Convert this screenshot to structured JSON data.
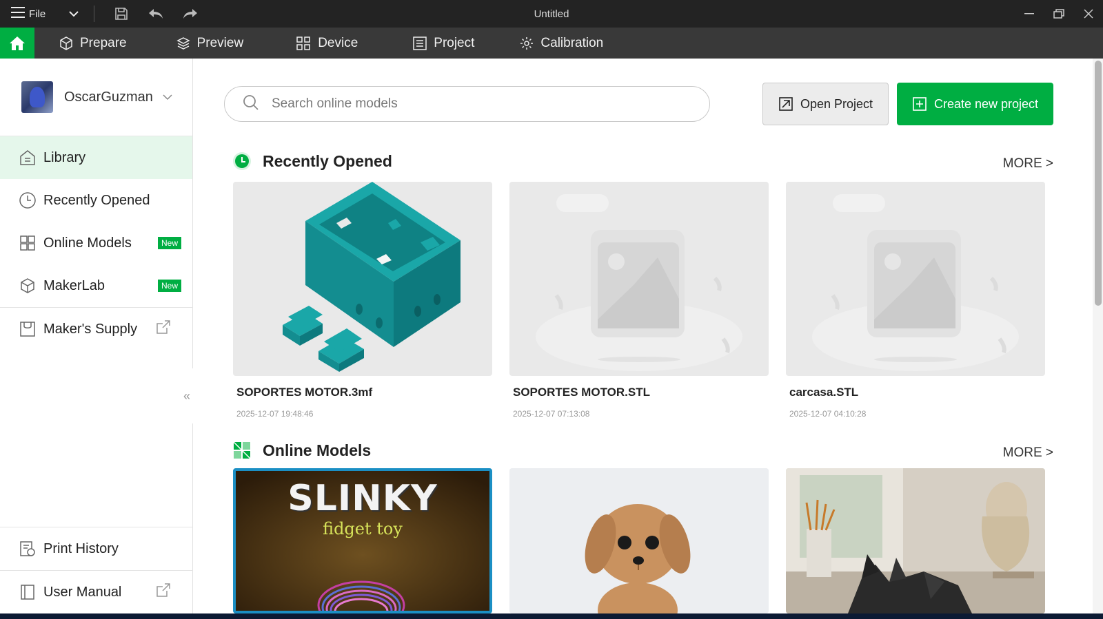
{
  "titlebar": {
    "file_label": "File",
    "title": "Untitled"
  },
  "nav": {
    "tabs": [
      {
        "label": "Prepare",
        "icon": "cube-icon"
      },
      {
        "label": "Preview",
        "icon": "layers-icon"
      },
      {
        "label": "Device",
        "icon": "device-icon"
      },
      {
        "label": "Project",
        "icon": "list-icon"
      },
      {
        "label": "Calibration",
        "icon": "gear-icon"
      }
    ]
  },
  "sidebar": {
    "username": "OscarGuzman",
    "items": [
      {
        "label": "Library",
        "icon": "home-icon",
        "active": true
      },
      {
        "label": "Recently Opened",
        "icon": "clock-icon"
      },
      {
        "label": "Online Models",
        "icon": "models-icon",
        "badge": "New"
      },
      {
        "label": "MakerLab",
        "icon": "makerlab-icon",
        "badge": "New"
      },
      {
        "label": "Maker's Supply",
        "icon": "store-icon"
      }
    ],
    "bottom": [
      {
        "label": "Print History",
        "icon": "history-icon"
      },
      {
        "label": "User Manual",
        "icon": "book-icon"
      }
    ]
  },
  "main": {
    "search_placeholder": "Search online models",
    "open_project": "Open Project",
    "create_project": "Create new project",
    "recent": {
      "title": "Recently Opened",
      "more": "MORE >",
      "items": [
        {
          "name": "SOPORTES MOTOR.3mf",
          "date": "2025-12-07 19:48:46"
        },
        {
          "name": "SOPORTES MOTOR.STL",
          "date": "2025-12-07 07:13:08"
        },
        {
          "name": "carcasa.STL",
          "date": "2025-12-07 04:10:28"
        }
      ]
    },
    "online": {
      "title": "Online Models",
      "more": "MORE >",
      "slinky_title": "SLINKY",
      "slinky_sub": "fidget toy"
    }
  },
  "colors": {
    "accent": "#00ae42",
    "titlebar": "#232323",
    "navbar": "#393939"
  }
}
